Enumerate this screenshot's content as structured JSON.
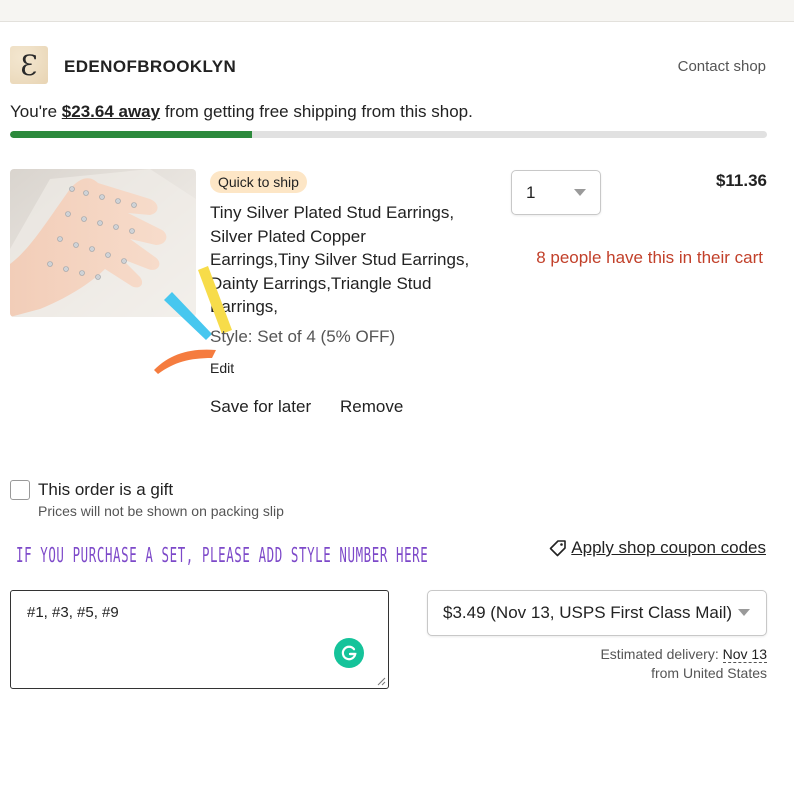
{
  "shop": {
    "logo_letter": "Ɛ",
    "name": "EDENOFBROOKLYN",
    "contact_label": "Contact shop"
  },
  "shipping_progress": {
    "prefix": "You're ",
    "amount": "$23.64 away",
    "suffix": " from getting free shipping from this shop.",
    "fraction": 0.32,
    "fill_color": "#2c8a3c"
  },
  "item": {
    "badge": "Quick to ship",
    "title_lines": [
      "Tiny Silver Plated Stud Earrings,",
      "Silver Plated Copper",
      "Earrings,Tiny Silver Stud Earrings,",
      "Dainty Earrings,Triangle Stud",
      "Earrings,"
    ],
    "style": "Style: Set of 4 (5% OFF)",
    "edit_label": "Edit",
    "save_for_later_label": "Save for later",
    "remove_label": "Remove",
    "quantity": "1",
    "price": "$11.36",
    "cart_note": "8 people have this in their cart",
    "cart_note_color": "#c2402a"
  },
  "gift": {
    "label": "This order is a gift",
    "sublabel": "Prices will not be shown on packing slip"
  },
  "annotation": {
    "text": "IF YOU PURCHASE A SET, PLEASE ADD STYLE NUMBER HERE",
    "color": "#7d49c9"
  },
  "note": {
    "value": "#1, #3, #5, #9",
    "grammarly_icon": "grammarly-icon"
  },
  "coupon": {
    "label": " Apply shop coupon codes",
    "icon": "tag-icon"
  },
  "shipping_option": {
    "value": "$3.49 (Nov 13, USPS First Class Mail)"
  },
  "estimate": {
    "label": "Estimated delivery: ",
    "date": "Nov 13",
    "origin": "from United States"
  }
}
